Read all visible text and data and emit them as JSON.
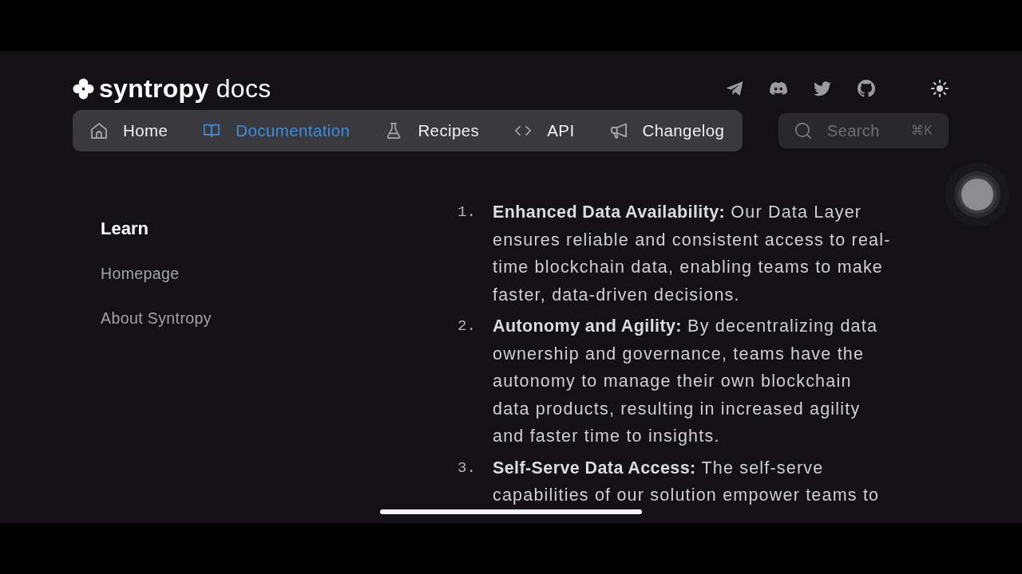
{
  "header": {
    "logo": {
      "name": "syntropy",
      "suffix": "docs"
    }
  },
  "nav": {
    "items": [
      {
        "label": "Home",
        "selected": false
      },
      {
        "label": "Documentation",
        "selected": true
      },
      {
        "label": "Recipes",
        "selected": false
      },
      {
        "label": "API",
        "selected": false
      },
      {
        "label": "Changelog",
        "selected": false
      }
    ]
  },
  "search": {
    "placeholder": "Search",
    "shortcut": "⌘K"
  },
  "sidebar": {
    "heading": "Learn",
    "items": [
      {
        "label": "Homepage",
        "selected": false
      },
      {
        "label": "About Syntropy",
        "selected": false
      }
    ]
  },
  "content": {
    "features": [
      {
        "number": "1.",
        "title": "Enhanced Data Availability:",
        "text": "Our Data Layer ensures reliable and consistent access to real-time blockchain data, enabling teams to make faster, data-driven decisions."
      },
      {
        "number": "2.",
        "title": "Autonomy and Agility:",
        "text": "By decentralizing data ownership and governance, teams have the autonomy to manage their own blockchain data products, resulting in increased agility and faster time to insights."
      },
      {
        "number": "3.",
        "title": "Self-Serve Data Access:",
        "text": "The self-serve capabilities of our solution empower teams to"
      }
    ]
  }
}
